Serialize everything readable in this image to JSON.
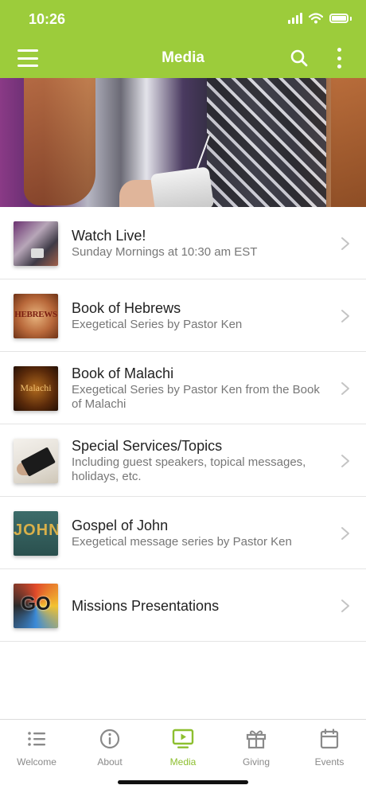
{
  "status": {
    "time": "10:26"
  },
  "header": {
    "title": "Media",
    "icons": {
      "menu": "hamburger-menu-icon",
      "search": "search-icon",
      "more": "more-vertical-icon"
    }
  },
  "colors": {
    "brand_green": "#9ccc3b",
    "active_tab": "#8dbf2f",
    "inactive_tab": "#8a8a8a"
  },
  "media_items": [
    {
      "title": "Watch Live!",
      "subtitle": "Sunday Mornings at 10:30 am EST"
    },
    {
      "title": "Book of Hebrews",
      "subtitle": "Exegetical Series by Pastor Ken",
      "thumb_text": "HEBREWS"
    },
    {
      "title": "Book of Malachi",
      "subtitle": "Exegetical Series by Pastor Ken from the Book of Malachi",
      "thumb_text": "Malachi"
    },
    {
      "title": "Special Services/Topics",
      "subtitle": "Including guest speakers, topical messages, holidays, etc."
    },
    {
      "title": "Gospel of John",
      "subtitle": "Exegetical message series by Pastor Ken",
      "thumb_text": "JOHN"
    },
    {
      "title": "Missions Presentations",
      "subtitle": "",
      "thumb_text": "GO"
    }
  ],
  "tabs": [
    {
      "label": "Welcome",
      "icon": "list-icon"
    },
    {
      "label": "About",
      "icon": "info-icon"
    },
    {
      "label": "Media",
      "icon": "play-screen-icon",
      "active": true
    },
    {
      "label": "Giving",
      "icon": "gift-icon"
    },
    {
      "label": "Events",
      "icon": "calendar-icon"
    }
  ]
}
